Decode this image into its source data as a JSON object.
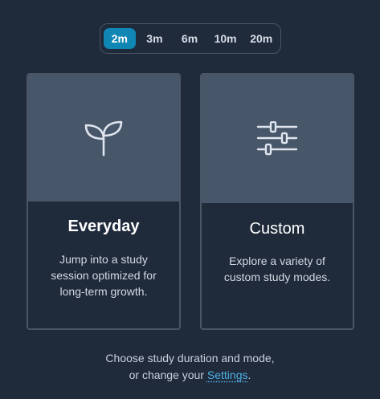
{
  "durations": {
    "options": [
      "2m",
      "3m",
      "6m",
      "10m",
      "20m"
    ],
    "selected": "2m"
  },
  "cards": [
    {
      "icon": "sprout-icon",
      "title": "Everyday",
      "description": "Jump into a study session optimized for long-term growth."
    },
    {
      "icon": "sliders-icon",
      "title": "Custom",
      "description": "Explore a variety of custom study modes."
    }
  ],
  "footer": {
    "line1": "Choose study duration and mode,",
    "line2_prefix": "or change your ",
    "settings_link": "Settings",
    "line2_suffix": "."
  },
  "colors": {
    "background": "#1f2a3b",
    "card_header": "#485669",
    "accent": "#0f86b4",
    "link": "#4fb0e3"
  }
}
